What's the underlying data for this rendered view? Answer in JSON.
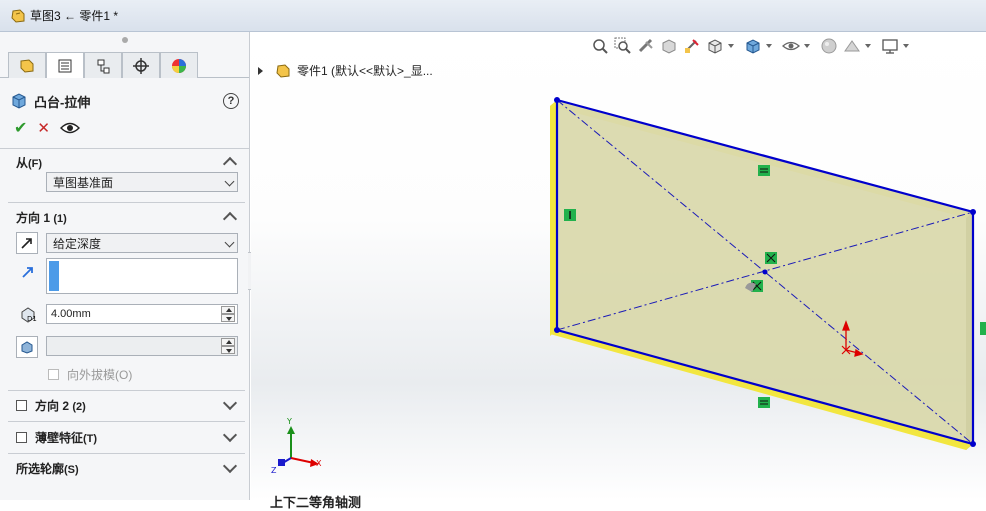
{
  "window": {
    "title": "草图3 ← 零件1 *"
  },
  "property_manager": {
    "tabs": [
      "feature-manager",
      "property-manager",
      "configuration-manager",
      "dimxpert-manager",
      "display-manager"
    ],
    "active_tab": "property-manager",
    "feature_title": "凸台-拉伸",
    "help_label": "?",
    "sections": {
      "from": {
        "title": "从",
        "shortcut": "(F)",
        "start_condition": "草图基准面"
      },
      "direction1": {
        "title": "方向 1",
        "shortcut": "(1)",
        "end_condition": "给定深度",
        "depth": "4.00mm",
        "draft_value": "",
        "draft_outward_label": "向外拔模",
        "draft_outward_shortcut": "(O)"
      },
      "direction2": {
        "title": "方向 2",
        "shortcut": "(2)",
        "checked": false
      },
      "thin_feature": {
        "title": "薄壁特征",
        "shortcut": "(T)",
        "checked": false
      },
      "selected_contours": {
        "title": "所选轮廓",
        "shortcut": "(S)"
      }
    }
  },
  "graphics": {
    "tree_root": "零件1  (默认<<默认>_显...",
    "heads_up_icons": [
      "zoom-to-fit-icon",
      "zoom-to-area-icon",
      "previous-view-icon",
      "section-view-icon",
      "dynamic-annotation-icon",
      "view-orientation-icon",
      "display-style-icon",
      "hide-show-icon",
      "edit-appearance-icon",
      "apply-scene-icon",
      "view-settings-icon"
    ],
    "triad": {
      "x": "X",
      "y": "Y",
      "z": "Z"
    },
    "footer_text": "上下二等角轴测",
    "colors": {
      "sketch_line": "#0000cc",
      "preview_fill": "#d8d7a8",
      "preview_edge": "#f2e640",
      "relation_marker": "#22b14c"
    }
  }
}
